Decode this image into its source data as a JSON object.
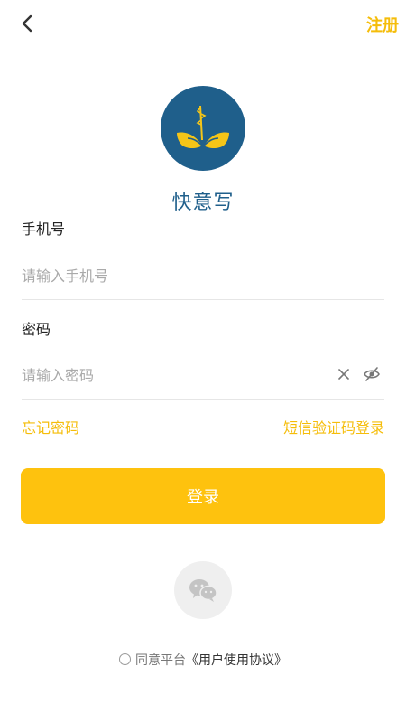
{
  "header": {
    "back_icon": "chevron-left-icon",
    "register_label": "注册"
  },
  "logo": {
    "icon": "book-quill-logo",
    "background_color": "#1F5F8B",
    "accent_color": "#F5C518"
  },
  "app_name": "快意写",
  "phone": {
    "label": "手机号",
    "placeholder": "请输入手机号",
    "value": ""
  },
  "password": {
    "label": "密码",
    "placeholder": "请输入密码",
    "value": "",
    "clear_icon": "close-icon",
    "visibility_icon": "eye-off-icon"
  },
  "links": {
    "forgot_password": "忘记密码",
    "sms_login": "短信验证码登录"
  },
  "login_button": "登录",
  "social": {
    "wechat_icon": "wechat-icon"
  },
  "agreement": {
    "checked": false,
    "prefix": "同意平台",
    "policy_link": "《用户使用协议》"
  },
  "colors": {
    "accent": "#F5BD0A",
    "button": "#FEC20E",
    "brand_blue": "#1F5F8B"
  }
}
